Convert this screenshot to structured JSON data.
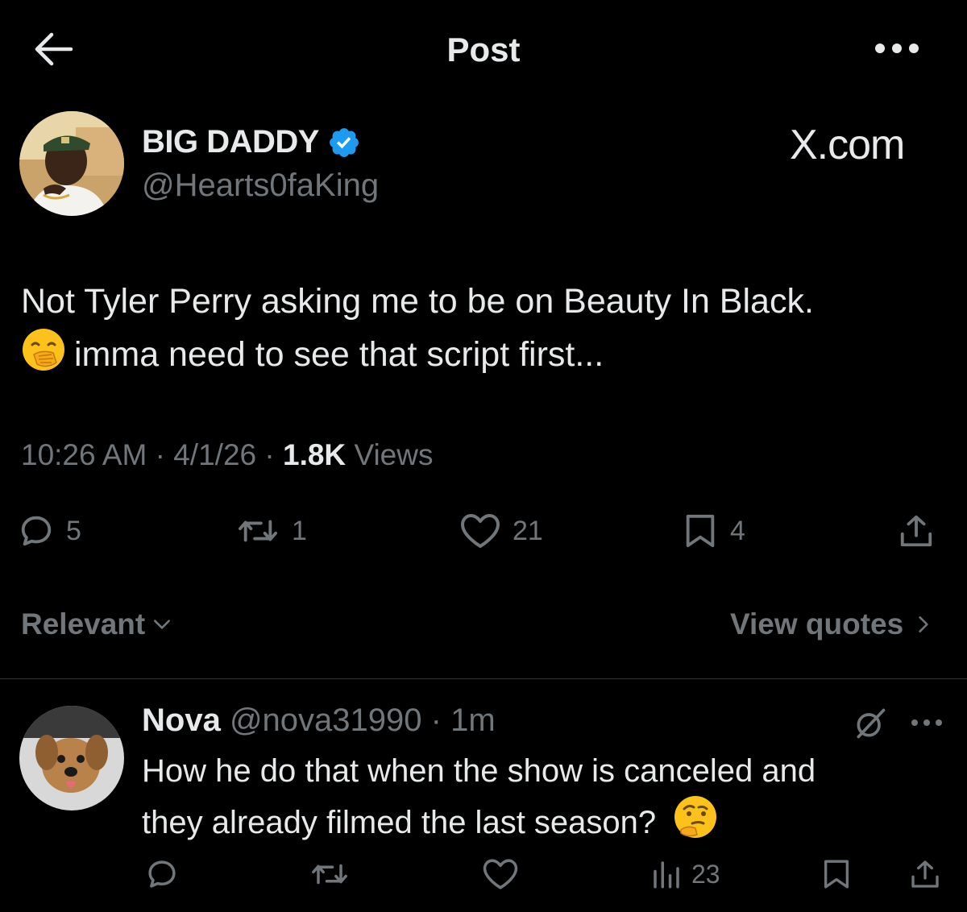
{
  "header": {
    "title": "Post"
  },
  "author": {
    "name": "BIG DADDY",
    "handle": "@Hearts0faKing",
    "verified": true
  },
  "watermark": "X.com",
  "tweet": {
    "line1": "Not Tyler Perry asking me to be on Beauty In Black.",
    "line2": "imma need to see that script first...",
    "emoji": "hand-over-mouth-emoji"
  },
  "meta": {
    "time": "10:26 AM",
    "date": "4/1/26",
    "views_count": "1.8K",
    "views_label": "Views",
    "sep": "·"
  },
  "actions": {
    "replies": "5",
    "reposts": "1",
    "likes": "21",
    "bookmarks": "4"
  },
  "sort": {
    "label": "Relevant"
  },
  "quotes": {
    "label": "View quotes"
  },
  "reply": {
    "name": "Nova",
    "handle": "@nova31990",
    "time": "1m",
    "line1": "How he do that when the show is canceled and",
    "line2": "they already filmed the last season?",
    "emoji": "thinking-face-emoji",
    "views": "23"
  },
  "colors": {
    "background": "#000000",
    "text": "#e7e9ea",
    "muted": "#71767b",
    "verified": "#1d9bf0",
    "divider": "#2f3336"
  }
}
